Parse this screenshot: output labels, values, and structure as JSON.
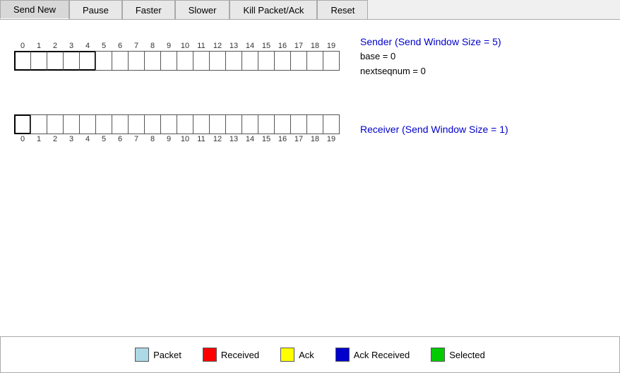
{
  "toolbar": {
    "buttons": [
      {
        "label": "Send New",
        "id": "send-new"
      },
      {
        "label": "Pause",
        "id": "pause"
      },
      {
        "label": "Faster",
        "id": "faster"
      },
      {
        "label": "Slower",
        "id": "slower"
      },
      {
        "label": "Kill Packet/Ack",
        "id": "kill"
      },
      {
        "label": "Reset",
        "id": "reset"
      }
    ]
  },
  "sender": {
    "title": "Sender (Send Window Size = 5)",
    "base_label": "base = 0",
    "nextseqnum_label": "nextseqnum = 0",
    "window_size": 5,
    "packet_count": 20
  },
  "receiver": {
    "title": "Receiver (Send Window Size = 1)",
    "window_size": 1,
    "packet_count": 20
  },
  "legend": {
    "items": [
      {
        "color": "#add8e6",
        "label": "Packet"
      },
      {
        "color": "#ff0000",
        "label": "Received"
      },
      {
        "color": "#ffff00",
        "label": "Ack"
      },
      {
        "color": "#0000cc",
        "label": "Ack Received"
      },
      {
        "color": "#00cc00",
        "label": "Selected"
      }
    ]
  }
}
